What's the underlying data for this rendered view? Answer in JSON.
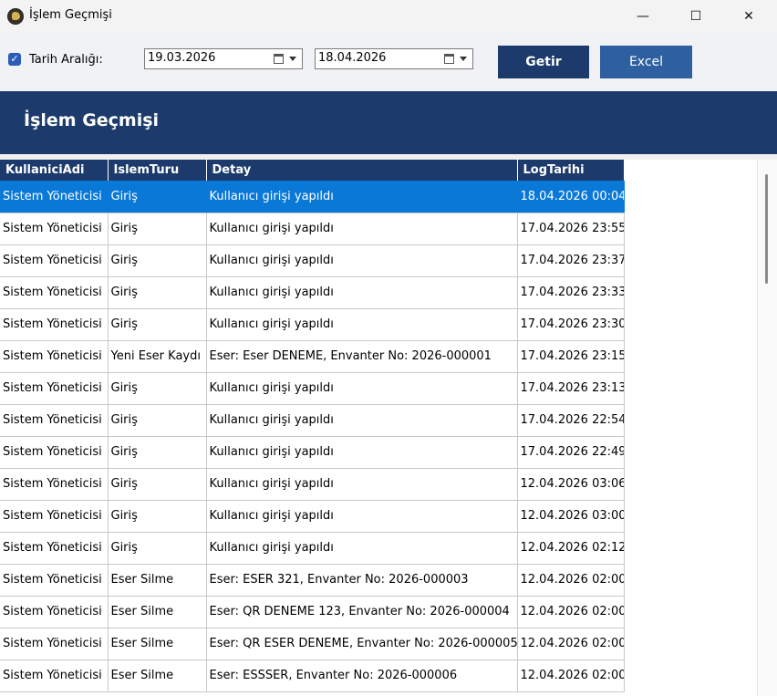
{
  "window": {
    "title": "İşlem Geçmişi",
    "min": "—",
    "max": "☐",
    "close": "✕"
  },
  "filter": {
    "checkbox_checked": true,
    "checkbox_label": "Tarih Aralığı:",
    "date_from": "19.03.2026",
    "date_to": "18.04.2026",
    "get_label": "Getir",
    "excel_label": "Excel"
  },
  "header": {
    "title": "İşlem Geçmişi"
  },
  "table": {
    "columns": [
      "KullaniciAdi",
      "IslemTuru",
      "Detay",
      "LogTarihi"
    ],
    "rows": [
      [
        "Sistem Yöneticisi",
        "Giriş",
        "Kullanıcı girişi yapıldı",
        "18.04.2026 00:04"
      ],
      [
        "Sistem Yöneticisi",
        "Giriş",
        "Kullanıcı girişi yapıldı",
        "17.04.2026 23:55"
      ],
      [
        "Sistem Yöneticisi",
        "Giriş",
        "Kullanıcı girişi yapıldı",
        "17.04.2026 23:37"
      ],
      [
        "Sistem Yöneticisi",
        "Giriş",
        "Kullanıcı girişi yapıldı",
        "17.04.2026 23:33"
      ],
      [
        "Sistem Yöneticisi",
        "Giriş",
        "Kullanıcı girişi yapıldı",
        "17.04.2026 23:30"
      ],
      [
        "Sistem Yöneticisi",
        "Yeni Eser Kaydı",
        "Eser: Eser DENEME, Envanter No: 2026-000001",
        "17.04.2026 23:15"
      ],
      [
        "Sistem Yöneticisi",
        "Giriş",
        "Kullanıcı girişi yapıldı",
        "17.04.2026 23:13"
      ],
      [
        "Sistem Yöneticisi",
        "Giriş",
        "Kullanıcı girişi yapıldı",
        "17.04.2026 22:54"
      ],
      [
        "Sistem Yöneticisi",
        "Giriş",
        "Kullanıcı girişi yapıldı",
        "17.04.2026 22:49"
      ],
      [
        "Sistem Yöneticisi",
        "Giriş",
        "Kullanıcı girişi yapıldı",
        "12.04.2026 03:06"
      ],
      [
        "Sistem Yöneticisi",
        "Giriş",
        "Kullanıcı girişi yapıldı",
        "12.04.2026 03:00"
      ],
      [
        "Sistem Yöneticisi",
        "Giriş",
        "Kullanıcı girişi yapıldı",
        "12.04.2026 02:12"
      ],
      [
        "Sistem Yöneticisi",
        "Eser Silme",
        "Eser: ESER 321, Envanter No: 2026-000003",
        "12.04.2026 02:00"
      ],
      [
        "Sistem Yöneticisi",
        "Eser Silme",
        "Eser: QR DENEME 123, Envanter No: 2026-000004",
        "12.04.2026 02:00"
      ],
      [
        "Sistem Yöneticisi",
        "Eser Silme",
        "Eser: QR ESER DENEME, Envanter No: 2026-000005",
        "12.04.2026 02:00"
      ],
      [
        "Sistem Yöneticisi",
        "Eser Silme",
        "Eser: ESSSER, Envanter No: 2026-000006",
        "12.04.2026 02:00"
      ]
    ],
    "selected_row": 0
  },
  "colors": {
    "header_bg": "#1c3a6b",
    "get_btn": "#1c3a6b",
    "excel_btn": "#2e5fa0",
    "selection": "#0a78d7"
  }
}
